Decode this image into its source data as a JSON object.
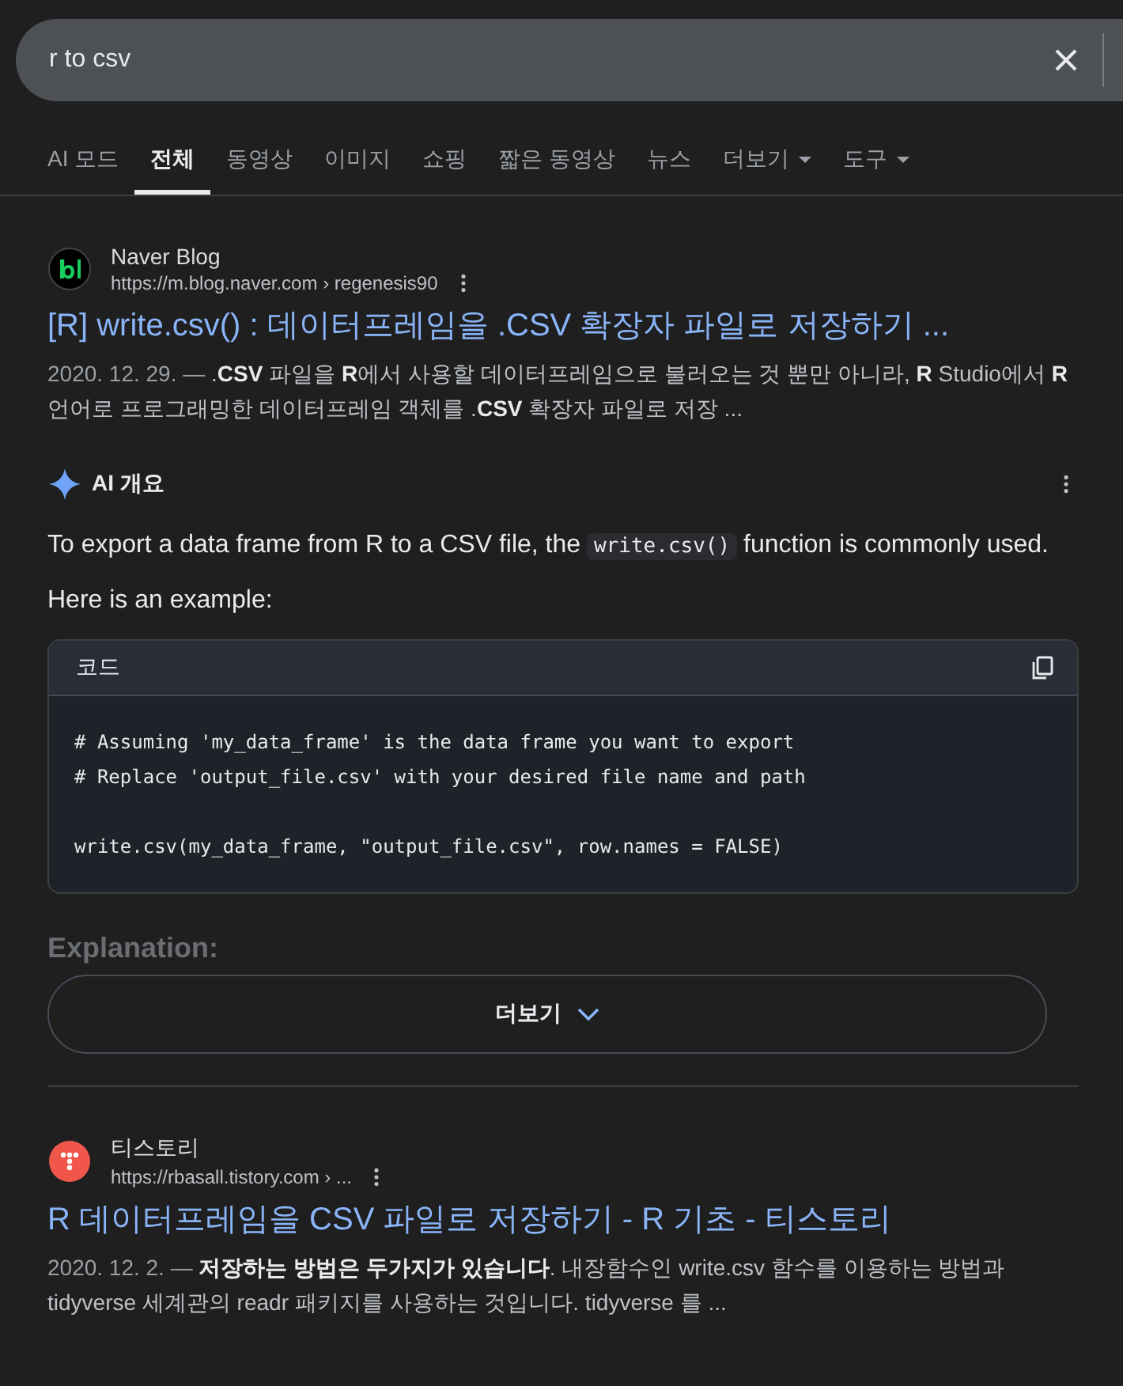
{
  "search": {
    "value": "r to csv"
  },
  "tabs": [
    {
      "label": "AI 모드",
      "selected": false,
      "dropdown": false
    },
    {
      "label": "전체",
      "selected": true,
      "dropdown": false
    },
    {
      "label": "동영상",
      "selected": false,
      "dropdown": false
    },
    {
      "label": "이미지",
      "selected": false,
      "dropdown": false
    },
    {
      "label": "쇼핑",
      "selected": false,
      "dropdown": false
    },
    {
      "label": "짧은 동영상",
      "selected": false,
      "dropdown": false
    },
    {
      "label": "뉴스",
      "selected": false,
      "dropdown": false
    },
    {
      "label": "더보기",
      "selected": false,
      "dropdown": true
    },
    {
      "label": "도구",
      "selected": false,
      "dropdown": true
    }
  ],
  "results": [
    {
      "kind": "naver",
      "site": "Naver Blog",
      "url": "https://m.blog.naver.com › regenesis90",
      "title": "[R] write.csv() : 데이터프레임을 .CSV 확장자 파일로 저장하기 ...",
      "date": "2020. 12. 29. —",
      "snippet": ".**CSV** 파일을 **R**에서 사용할 데이터프레임으로 불러오는 것 뿐만 아니라, **R** Studio에서 **R** 언어로 프로그래밍한 데이터프레임 객체를 .**CSV** 확장자 파일로 저장 ..."
    }
  ],
  "ai_overview": {
    "title": "AI 개요",
    "intro_before": "To export a data frame from R to a CSV file, the",
    "intro_code": "write.csv()",
    "intro_after": "function is commonly used.",
    "example_label": "Here is an example:",
    "code_block": {
      "label": "코드",
      "line_groups": [
        [
          "# Assuming 'my_data_frame' is the data frame you want to export",
          "# Replace 'output_file.csv' with your desired file name and path"
        ],
        [
          "write.csv(my_data_frame, \"output_file.csv\", row.names = FALSE)"
        ]
      ]
    },
    "faded_heading": "Explanation:",
    "more_button": "더보기"
  },
  "results_after": [
    {
      "kind": "tistory",
      "site": "티스토리",
      "url": "https://rbasall.tistory.com › ...",
      "title": "R 데이터프레임을 CSV 파일로 저장하기 - R 기초 - 티스토리",
      "date": "2020. 12. 2. —",
      "snippet": "**저장하는 방법은 두가지가 있습니다**. 내장함수인 write.csv 함수를 이용하는 방법과 tidyverse 세계관의 readr 패키지를 사용하는 것입니다. tidyverse 를 ..."
    }
  ]
}
